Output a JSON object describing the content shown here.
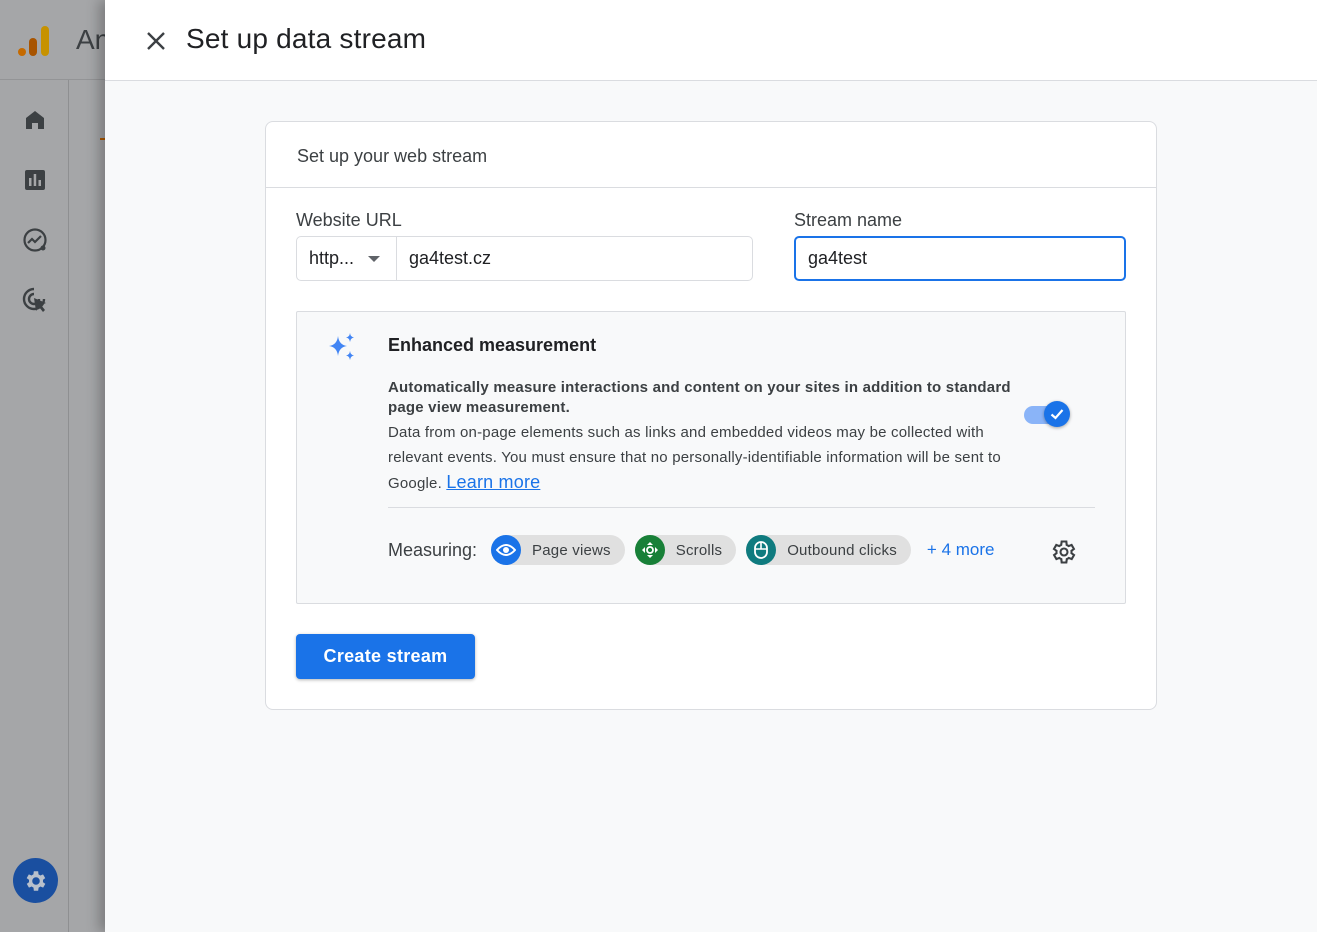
{
  "background_app": {
    "title_partial": "An",
    "rail_items": [
      {
        "icon": "home-icon"
      },
      {
        "icon": "reports-icon"
      },
      {
        "icon": "explore-icon"
      },
      {
        "icon": "advertising-icon"
      }
    ],
    "admin_icon": "gear-icon"
  },
  "drawer": {
    "title": "Set up data stream",
    "close_icon": "close-icon"
  },
  "card": {
    "heading": "Set up your web stream",
    "website_url": {
      "label": "Website URL",
      "protocol_selected": "http...",
      "value": "ga4test.cz"
    },
    "stream_name": {
      "label": "Stream name",
      "value": "ga4test"
    },
    "enhanced_measurement": {
      "icon": "sparkle-icon",
      "title": "Enhanced measurement",
      "bold_description": "Automatically measure interactions and content on your sites in addition to standard page view measurement.",
      "description": "Data from on-page elements such as links and embedded videos may be collected with relevant events. You must ensure that no personally-identifiable information will be sent to Google.",
      "learn_more": "Learn more",
      "enabled": true,
      "measuring_label": "Measuring:",
      "chips": [
        {
          "label": "Page views",
          "icon": "eye-icon",
          "color": "#1a73e8"
        },
        {
          "label": "Scrolls",
          "icon": "scroll-icon",
          "color": "#188038"
        },
        {
          "label": "Outbound clicks",
          "icon": "mouse-icon",
          "color": "#0f7b7f"
        }
      ],
      "more_label": "+ 4 more",
      "settings_icon": "gear-icon"
    },
    "create_button": "Create stream"
  },
  "colors": {
    "primary": "#1a73e8",
    "toggle_track": "#8ab4f8",
    "border": "#dadce0"
  }
}
